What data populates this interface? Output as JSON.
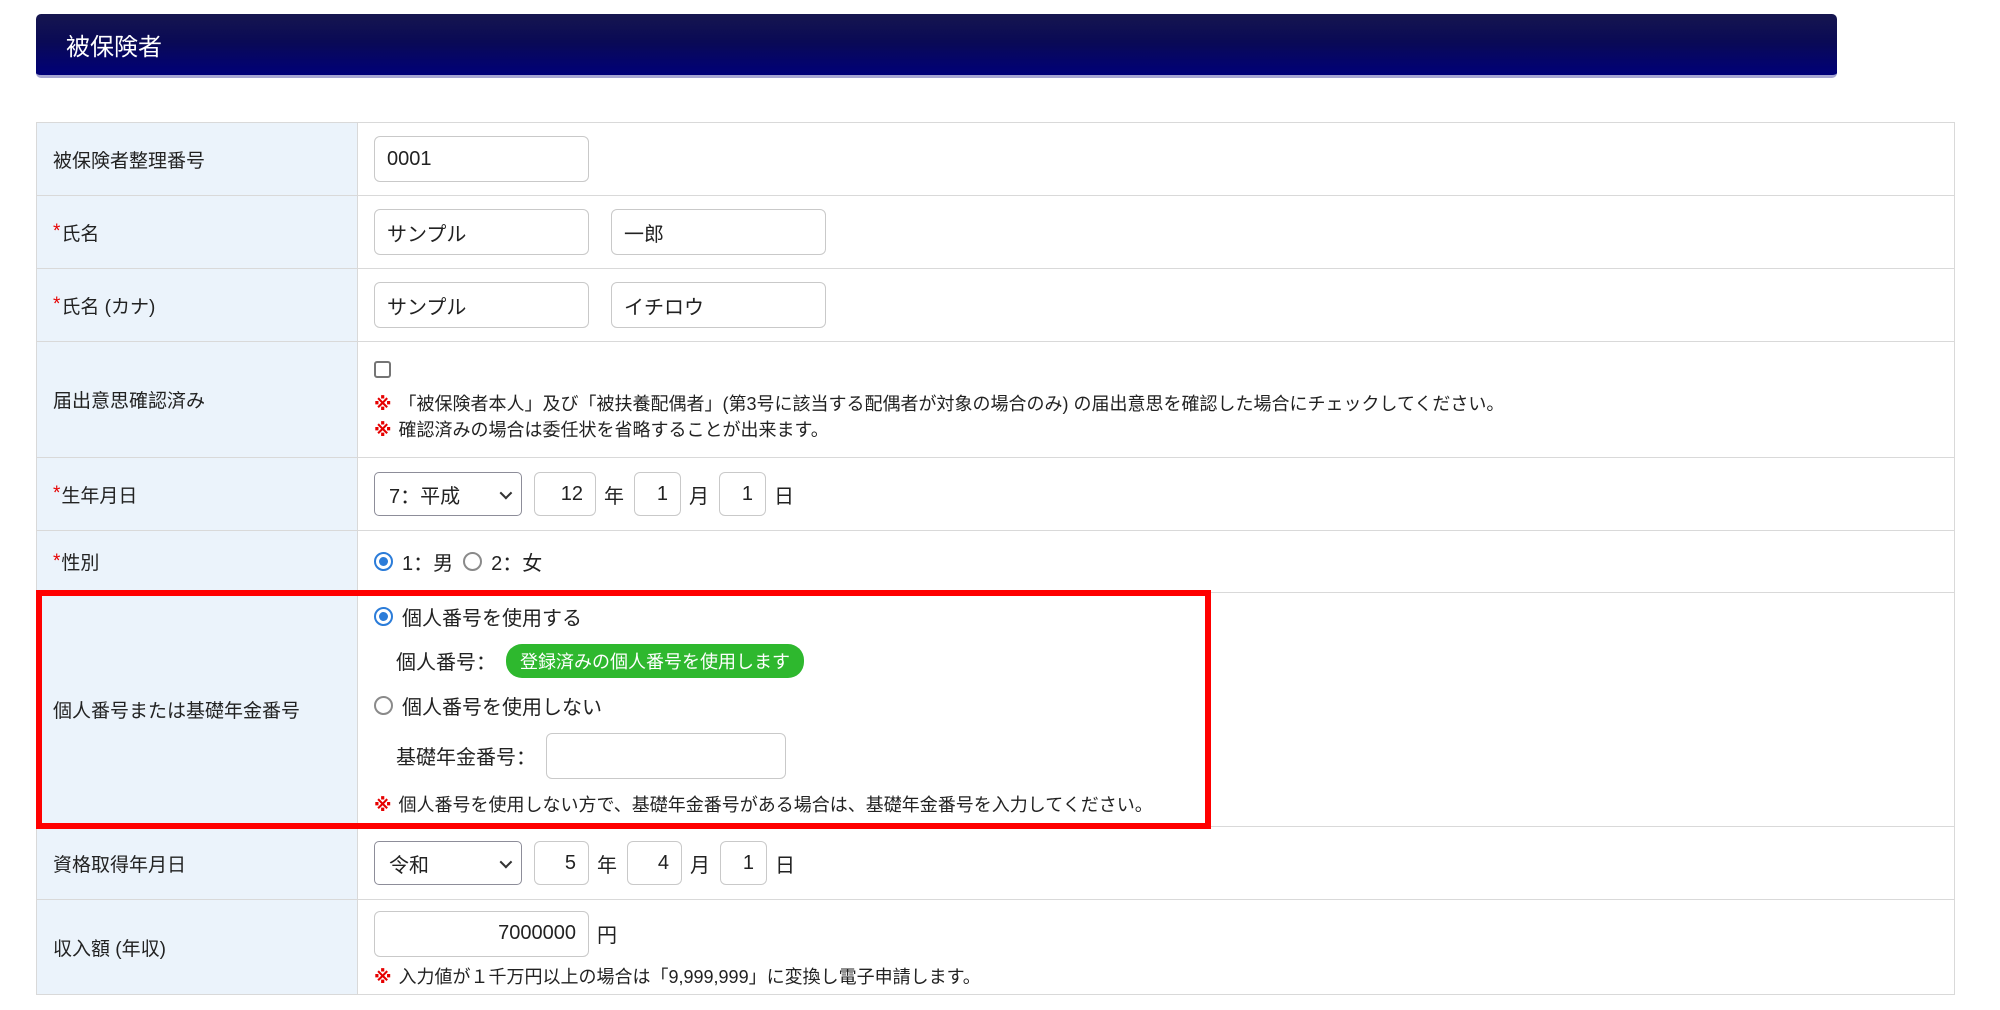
{
  "section": {
    "title": "被保険者"
  },
  "shared": {
    "required_mark": "*",
    "note_marker": "※",
    "units": {
      "year": "年",
      "month": "月",
      "day": "日",
      "yen": "円"
    }
  },
  "rows": {
    "insured_number": {
      "label": "被保険者整理番号",
      "value": "0001"
    },
    "name": {
      "label": "氏名",
      "family": "サンプル",
      "given": "一郎"
    },
    "name_kana": {
      "label": "氏名 (カナ)",
      "family": "サンプル",
      "given": "イチロウ"
    },
    "intent": {
      "label": "届出意思確認済み",
      "notes": [
        {
          "text": "「被保険者本人」及び「被扶養配偶者」(第3号に該当する配偶者が対象の場合のみ) の届出意思を確認した場合にチェックしてください。"
        },
        {
          "text": "確認済みの場合は委任状を省略することが出来ます。"
        }
      ]
    },
    "birth_date": {
      "label": "生年月日",
      "era": "7：平成",
      "year": "12",
      "month": "1",
      "day": "1"
    },
    "gender": {
      "label": "性別",
      "options": [
        {
          "label": "1：男"
        },
        {
          "label": "2：女"
        }
      ],
      "selected": "1：男"
    },
    "personal_number": {
      "label": "個人番号または基礎年金番号",
      "use_option": "個人番号を使用する",
      "personal_label": "個人番号：",
      "badge": "登録済みの個人番号を使用します",
      "not_use_option": "個人番号を使用しない",
      "pension_label": "基礎年金番号：",
      "pension_value": "",
      "note": "個人番号を使用しない方で、基礎年金番号がある場合は、基礎年金番号を入力してください。"
    },
    "acquisition_date": {
      "label": "資格取得年月日",
      "era": "令和",
      "year": "5",
      "month": "4",
      "day": "1"
    },
    "income": {
      "label": "収入額 (年収)",
      "value": "7000000",
      "note": "入力値が１千万円以上の場合は「9,999,999」に変換し電子申請します。"
    }
  },
  "colors": {
    "header_gradient_top": "#16164f",
    "header_gradient_bottom": "#000078",
    "label_cell_bg": "#ebf3fb",
    "table_border": "#d9d9d9",
    "required_red": "#e60000",
    "highlight_red": "#ff0000",
    "badge_green": "#2eb82e",
    "radio_blue": "#2b7cd9"
  }
}
